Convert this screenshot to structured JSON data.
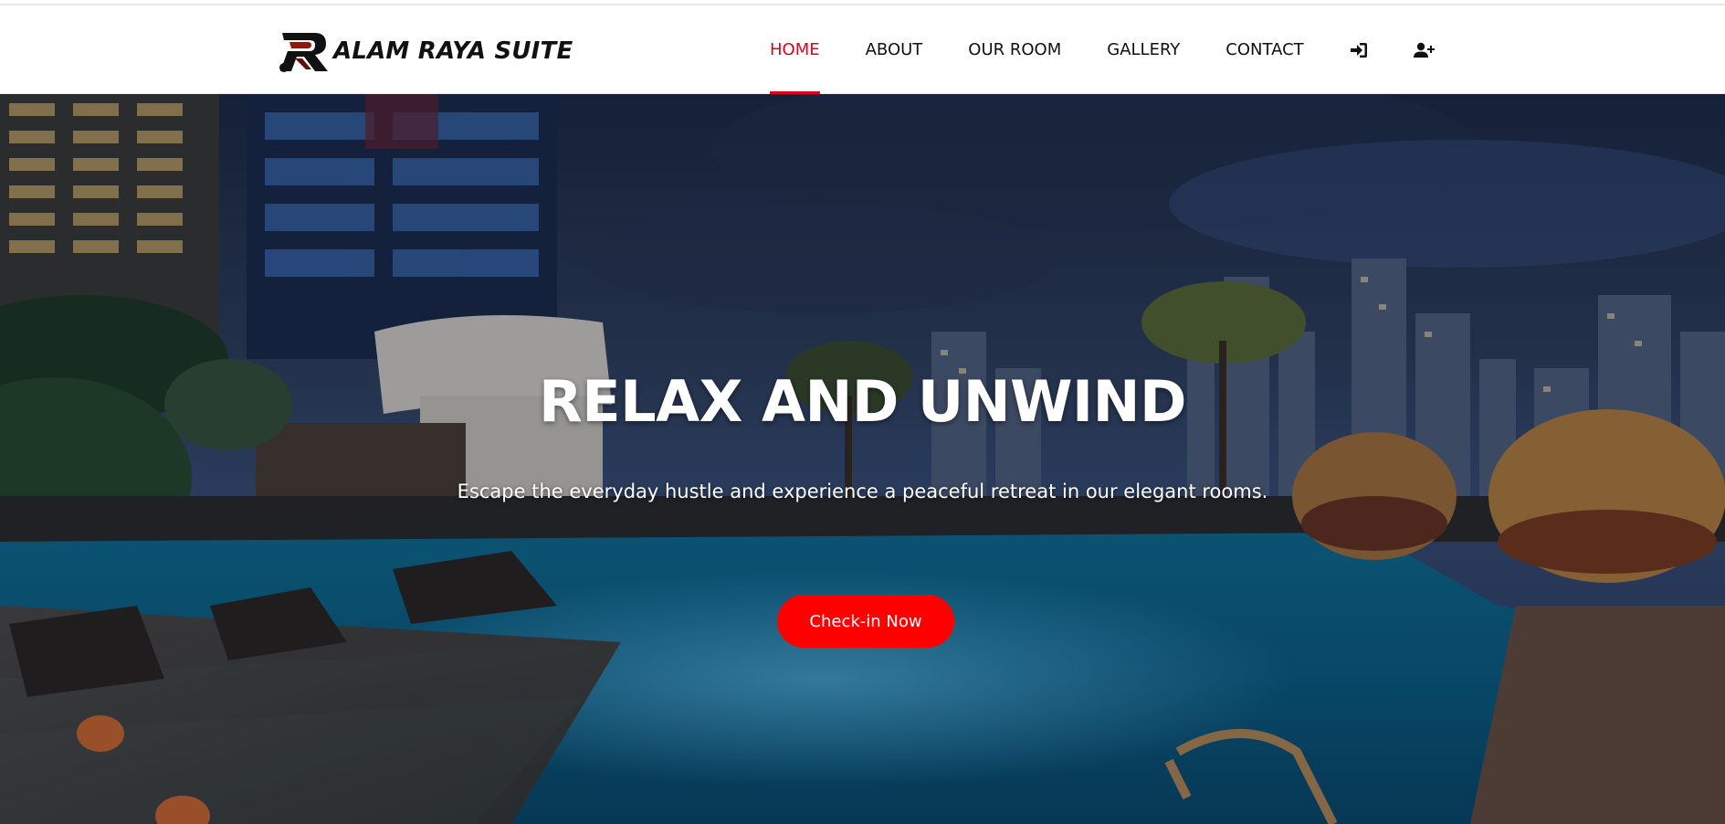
{
  "brand": {
    "name": "ALAM RAYA",
    "suffix": "SUITE",
    "logo_icon": "stylized-r-logo",
    "accent_color": "#e3001b"
  },
  "nav": {
    "items": [
      {
        "label": "HOME",
        "active": true
      },
      {
        "label": "ABOUT",
        "active": false
      },
      {
        "label": "OUR ROOM",
        "active": false
      },
      {
        "label": "GALLERY",
        "active": false
      },
      {
        "label": "CONTACT",
        "active": false
      }
    ],
    "icons": [
      "sign-in-icon",
      "user-plus-icon"
    ]
  },
  "hero": {
    "title": "RELAX AND UNWIND",
    "subtitle": "Escape the everyday hustle and experience a peaceful retreat in our elegant rooms.",
    "cta_label": "Check-in Now",
    "cta_color": "#ff0000",
    "background": "rooftop-pool-city-night-photo"
  }
}
